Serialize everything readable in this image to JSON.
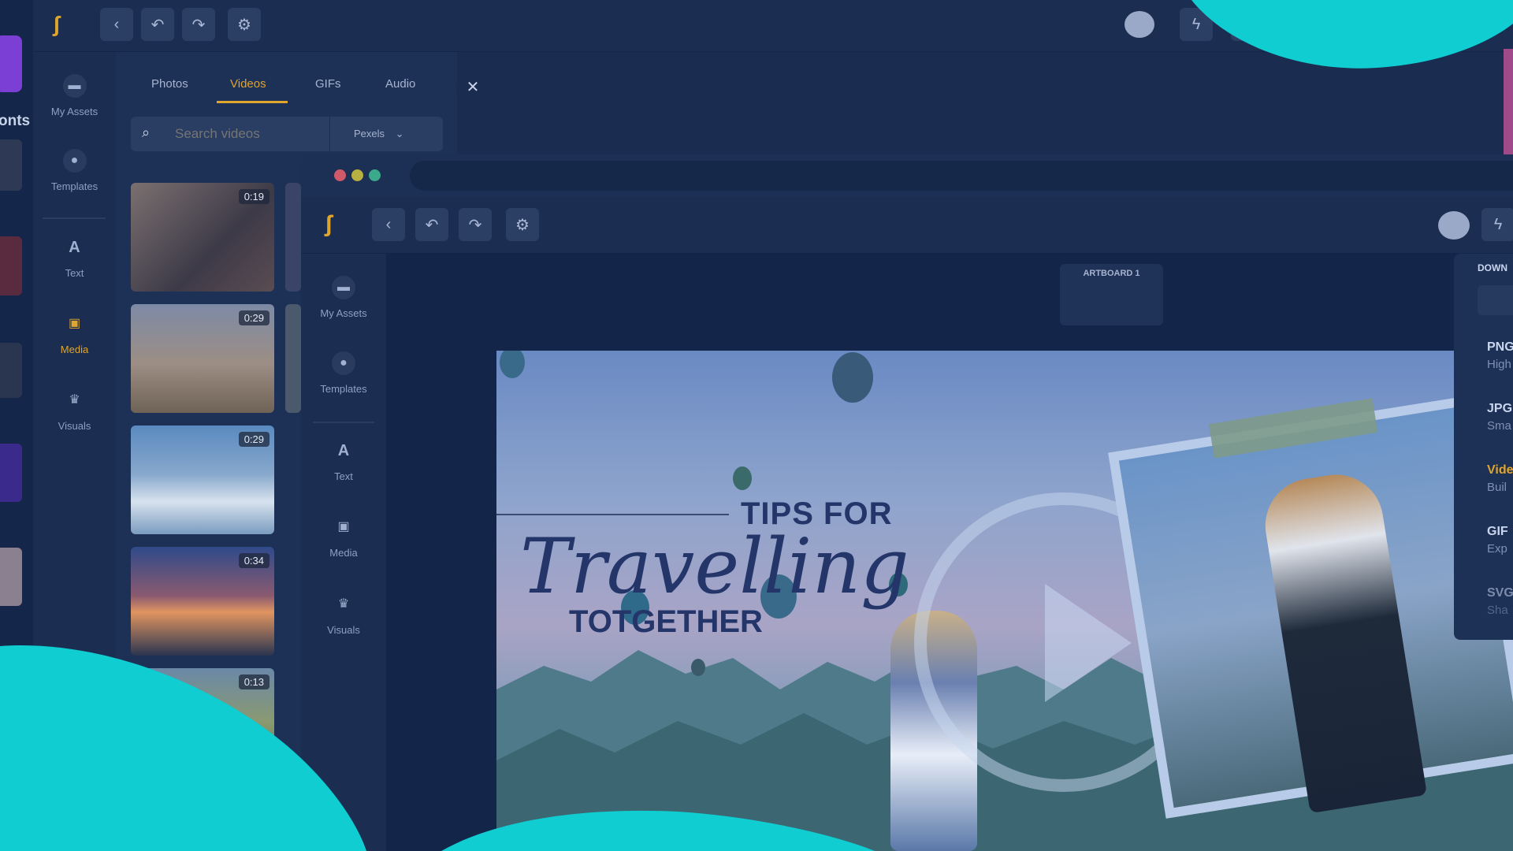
{
  "back_window": {
    "tabs": [
      "Photos",
      "Videos",
      "GIFs",
      "Audio"
    ],
    "active_tab": "Videos",
    "search_placeholder": "Search videos",
    "source_select": "Pexels",
    "nav": [
      {
        "label": "My Assets",
        "icon": "folder-icon"
      },
      {
        "label": "Templates",
        "icon": "drop-icon"
      },
      {
        "label": "Text",
        "icon": "text-icon"
      },
      {
        "label": "Media",
        "icon": "image-icon"
      },
      {
        "label": "Visuals",
        "icon": "crown-icon"
      }
    ],
    "active_nav": "Media",
    "left_cut_label": "onts",
    "video_durations": [
      "0:19",
      "0:29",
      "0:29",
      "0:34",
      "0:13"
    ]
  },
  "front_window": {
    "nav": [
      {
        "label": "My Assets",
        "icon": "folder-icon"
      },
      {
        "label": "Templates",
        "icon": "drop-icon"
      },
      {
        "label": "Text",
        "icon": "text-icon"
      },
      {
        "label": "Media",
        "icon": "image-icon"
      },
      {
        "label": "Visuals",
        "icon": "crown-icon"
      }
    ],
    "artboard_label": "ARTBOARD 1",
    "design": {
      "line1": "TIPS FOR",
      "script": "Travelling",
      "line3": "TOTGETHER"
    },
    "download_panel": {
      "title": "DOWN",
      "options": [
        {
          "name": "PNG",
          "desc": "High"
        },
        {
          "name": "JPG",
          "desc": "Sma"
        },
        {
          "name": "Vide",
          "desc": "Buil"
        },
        {
          "name": "GIF",
          "desc": "Exp"
        },
        {
          "name": "SVG",
          "desc": "Sha"
        }
      ]
    }
  },
  "colors": {
    "bg": "#112447",
    "window": "#1b2e52",
    "accent": "#e0a52c",
    "teal": "#0fcdd1"
  }
}
